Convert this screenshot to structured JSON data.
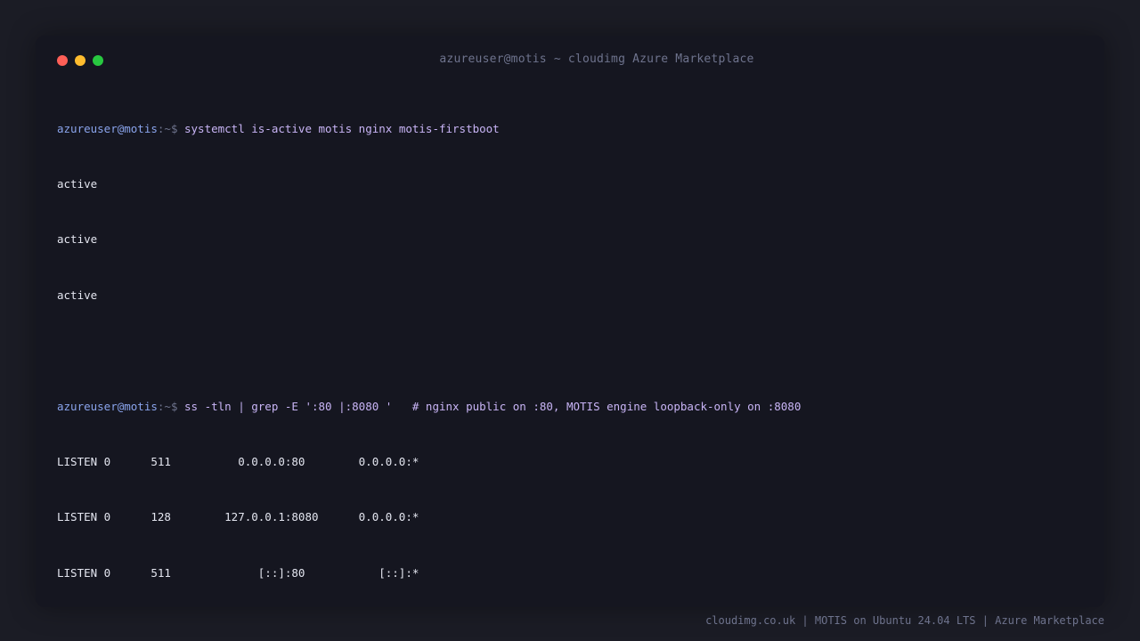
{
  "window": {
    "title": "azureuser@motis ~ cloudimg Azure Marketplace",
    "controls": [
      {
        "name": "close",
        "color": "#ff5f57"
      },
      {
        "name": "minimize",
        "color": "#febc2e"
      },
      {
        "name": "maximize",
        "color": "#28c840"
      }
    ]
  },
  "terminal": {
    "blocks": [
      {
        "prompt_user": "azureuser@motis",
        "prompt_path": ":~$ ",
        "command": "systemctl is-active motis nginx motis-firstboot",
        "output": [
          "active",
          "active",
          "active"
        ]
      },
      {
        "prompt_user": "azureuser@motis",
        "prompt_path": ":~$ ",
        "command": "ss -tln | grep -E ':80 |:8080 '   # nginx public on :80, MOTIS engine loopback-only on :8080",
        "output": [
          "LISTEN 0      511          0.0.0.0:80        0.0.0.0:*",
          "LISTEN 0      128        127.0.0.1:8080      0.0.0.0:*",
          "LISTEN 0      511             [::]:80           [::]:*"
        ]
      }
    ]
  },
  "footer": {
    "text": "cloudimg.co.uk | MOTIS on Ubuntu 24.04 LTS | Azure Marketplace"
  }
}
